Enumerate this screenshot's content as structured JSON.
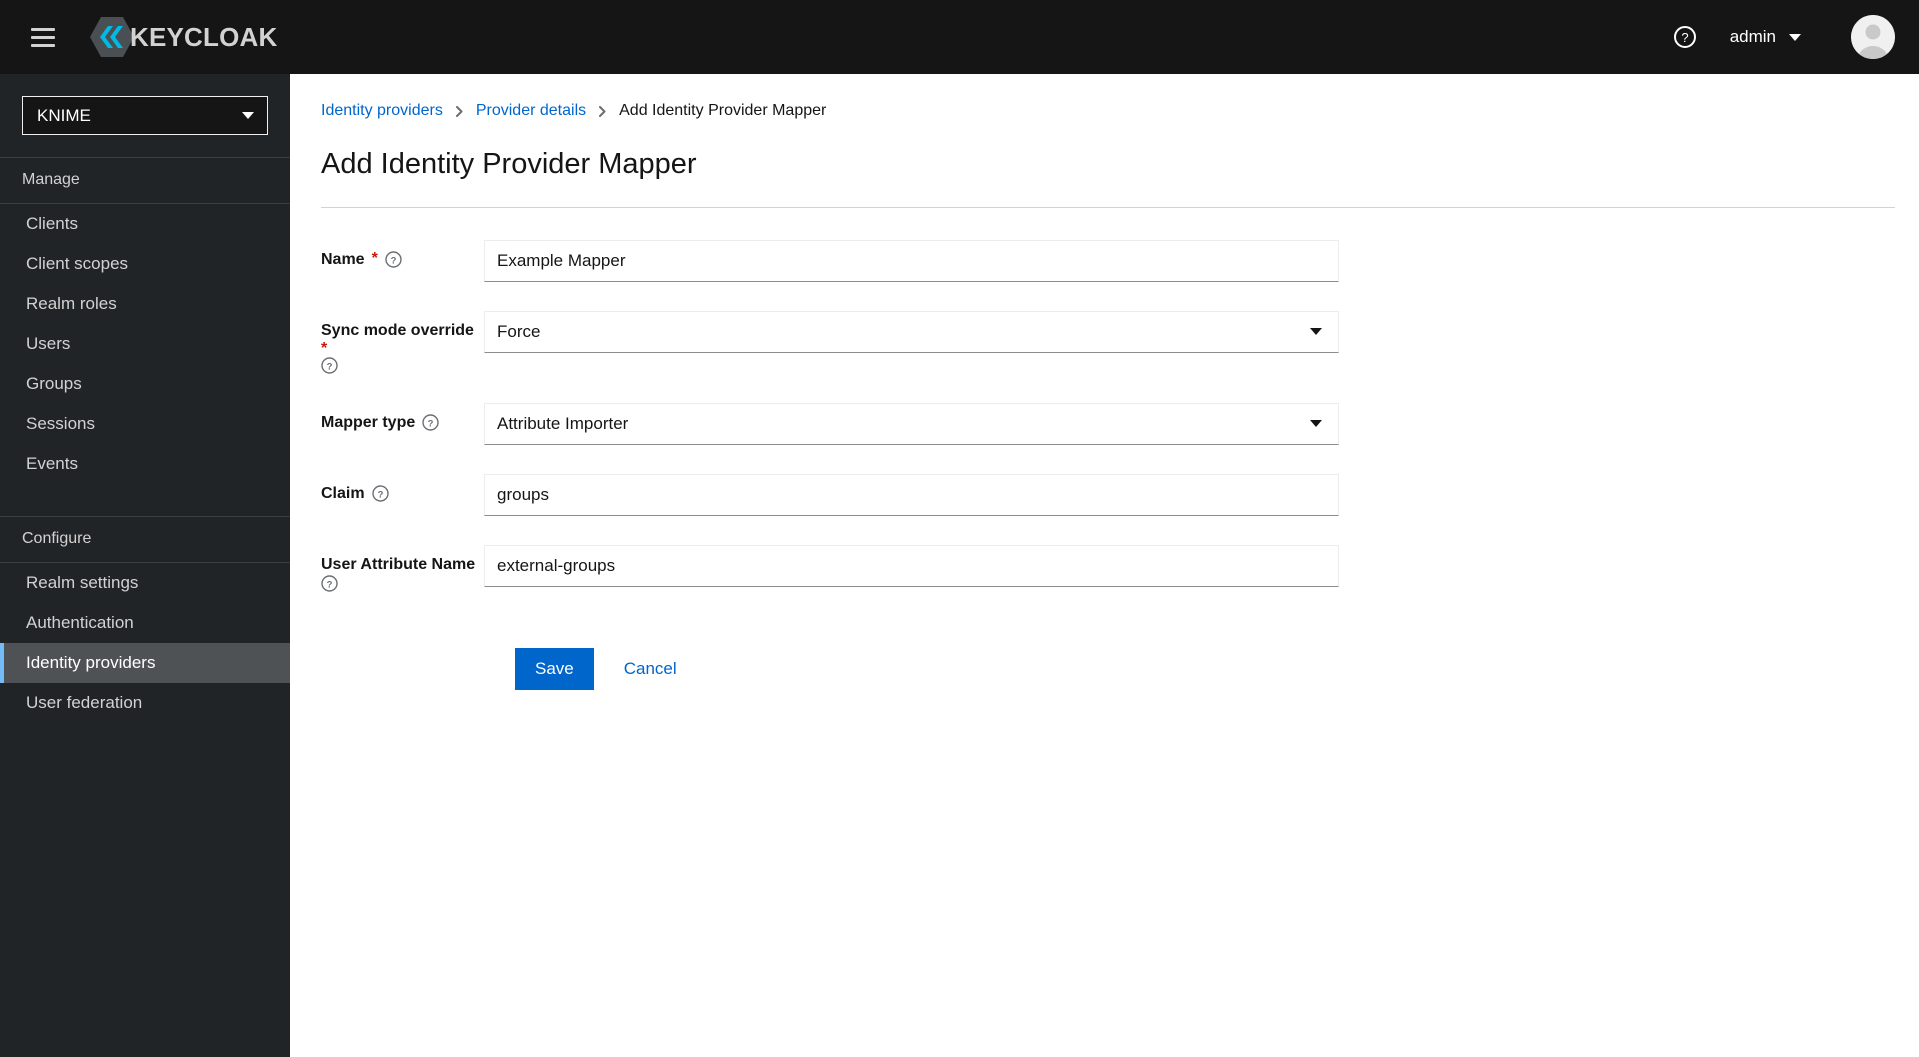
{
  "masthead": {
    "hamburger_label": "Global navigation",
    "brand_name": "KEYCLOAK",
    "help_label": "Help",
    "user_name": "admin",
    "avatar_label": "User avatar"
  },
  "sidebar": {
    "realm_selector": {
      "value": "KNIME"
    },
    "sections": [
      {
        "title": "Manage",
        "items": [
          {
            "label": "Clients",
            "active": false
          },
          {
            "label": "Client scopes",
            "active": false
          },
          {
            "label": "Realm roles",
            "active": false
          },
          {
            "label": "Users",
            "active": false
          },
          {
            "label": "Groups",
            "active": false
          },
          {
            "label": "Sessions",
            "active": false
          },
          {
            "label": "Events",
            "active": false
          }
        ]
      },
      {
        "title": "Configure",
        "items": [
          {
            "label": "Realm settings",
            "active": false
          },
          {
            "label": "Authentication",
            "active": false
          },
          {
            "label": "Identity providers",
            "active": true
          },
          {
            "label": "User federation",
            "active": false
          }
        ]
      }
    ]
  },
  "content": {
    "breadcrumb": [
      {
        "label": "Identity providers",
        "link": true
      },
      {
        "label": "Provider details",
        "link": true
      },
      {
        "label": "Add Identity Provider Mapper",
        "link": false
      }
    ],
    "page_title": "Add Identity Provider Mapper",
    "form": {
      "fields": [
        {
          "label": "Name",
          "required": true,
          "help": true,
          "help_wraps": false,
          "type": "text",
          "value": "Example Mapper",
          "placeholder": ""
        },
        {
          "label": "Sync mode override",
          "required": true,
          "help": true,
          "help_wraps": true,
          "type": "select",
          "value": "Force",
          "placeholder": ""
        },
        {
          "label": "Mapper type",
          "required": false,
          "help": true,
          "help_wraps": false,
          "type": "select",
          "value": "Attribute Importer",
          "placeholder": ""
        },
        {
          "label": "Claim",
          "required": false,
          "help": true,
          "help_wraps": false,
          "type": "text",
          "value": "groups",
          "placeholder": ""
        },
        {
          "label": "User Attribute Name",
          "required": false,
          "help": true,
          "help_wraps": true,
          "type": "text",
          "value": "external-groups",
          "placeholder": ""
        }
      ],
      "save_label": "Save",
      "cancel_label": "Cancel"
    }
  },
  "colors": {
    "masthead_bg": "#151515",
    "sidebar_bg": "#212427",
    "active_nav_bg": "#4f5255",
    "active_nav_accent": "#73bcf7",
    "link_blue": "#0066cc",
    "primary_button": "#0066cc",
    "required_red": "#c9190b",
    "brand_blue": "#4fc3f7"
  }
}
